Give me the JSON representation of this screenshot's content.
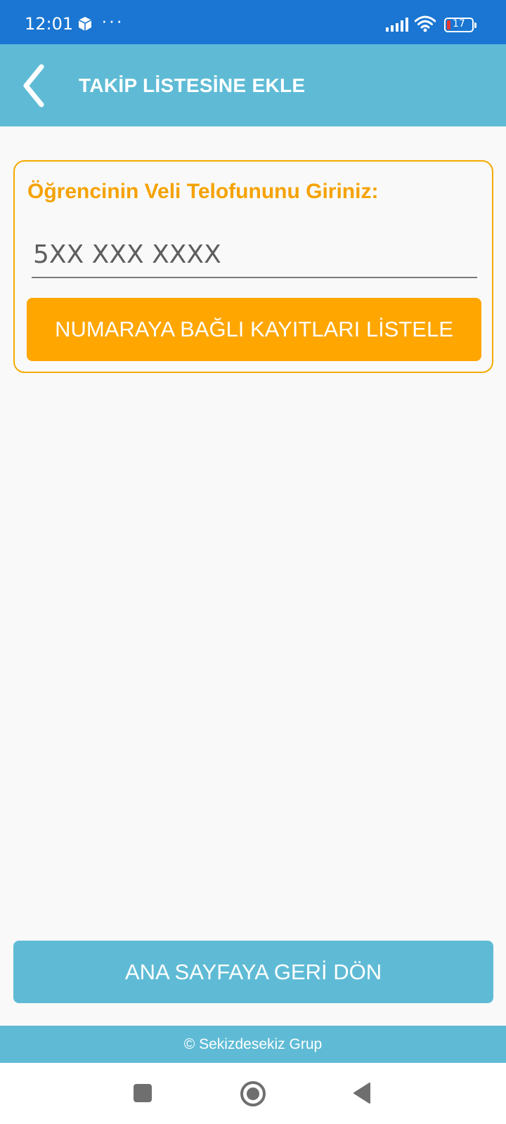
{
  "status_bar": {
    "time": "12:01",
    "more_indicator": "···",
    "battery_level": "17",
    "icons": [
      "box-icon",
      "signal-icon",
      "wifi-icon",
      "battery-icon"
    ]
  },
  "app_bar": {
    "title": "TAKİP LİSTESİNE EKLE",
    "back_icon": "chevron-left-icon"
  },
  "form": {
    "label": "Öğrencinin Veli Telofununu Giriniz:",
    "phone_value": "",
    "phone_placeholder": "5XX XXX XXXX",
    "list_button_label": "NUMARAYA BAĞLI KAYITLARI LİSTELE"
  },
  "home_button_label": "ANA SAYFAYA GERİ DÖN",
  "footer_text": "© Sekizdesekiz Grup",
  "nav_bar": {
    "icons": [
      "recent-apps-icon",
      "home-icon",
      "back-triangle-icon"
    ]
  },
  "colors": {
    "status_bar": "#1a76d2",
    "primary": "#5fbbd5",
    "accent": "#ffa600",
    "label": "#f5a200"
  }
}
